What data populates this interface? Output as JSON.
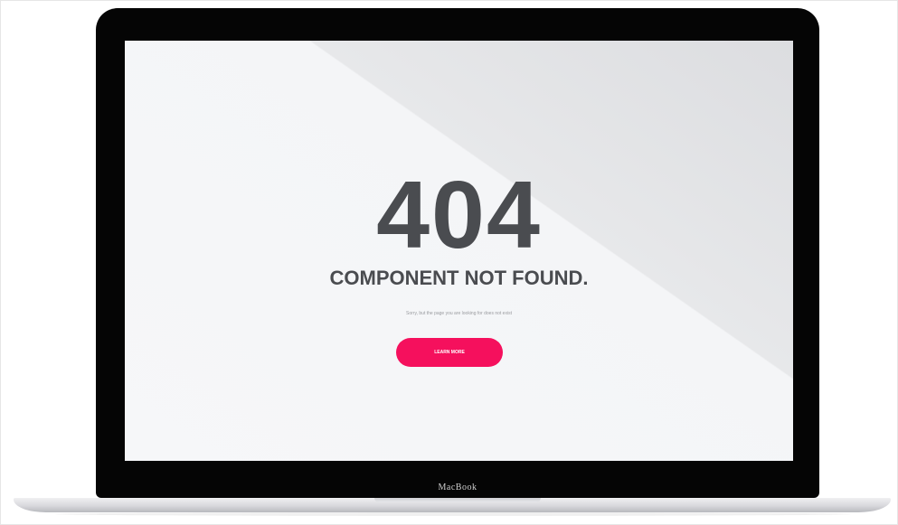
{
  "screen": {
    "error_code": "404",
    "title": "COMPONENT NOT FOUND.",
    "message": "Sorry, but the page you are looking for does not exist",
    "button_label": "LEARN MORE",
    "button_color": "#f5105d",
    "text_color": "#4a4c50"
  },
  "device": {
    "brand_label": "MacBook"
  }
}
